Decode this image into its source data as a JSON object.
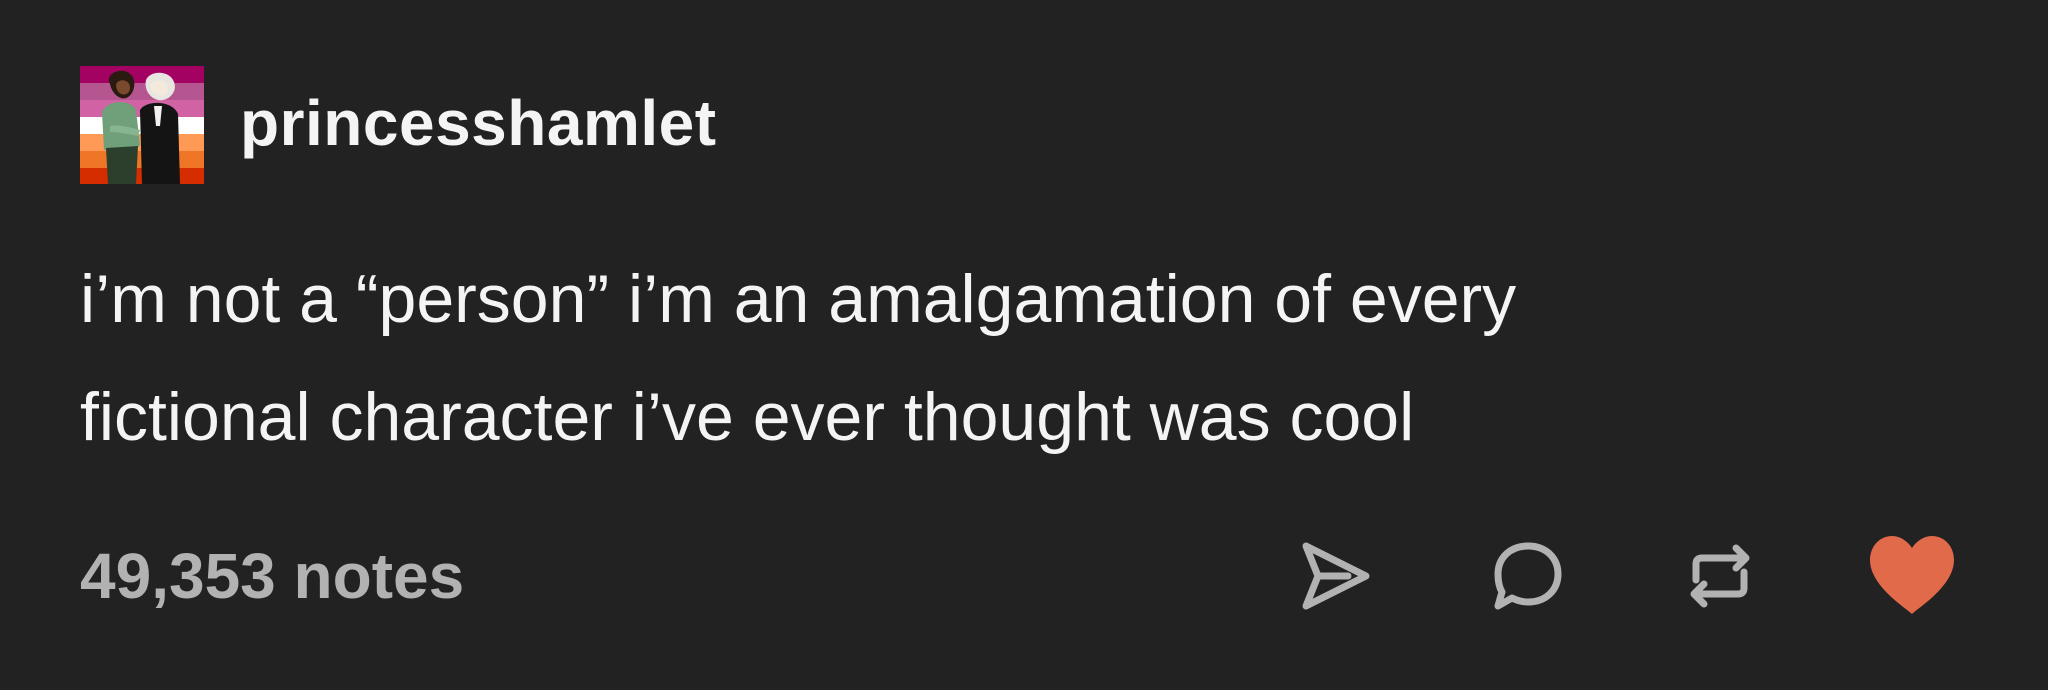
{
  "post": {
    "username": "princesshamlet",
    "text_lines": [
      "i’m not a “person” i’m an amalgamation of every",
      "fictional character i’ve ever thought was cool"
    ],
    "notes_label": "49,353 notes"
  },
  "icons": {
    "share": "share-icon",
    "reply": "reply-icon",
    "reblog": "reblog-icon",
    "like": "heart-icon"
  },
  "colors": {
    "background": "#222222",
    "text": "#f4f4f4",
    "muted": "#b2b2b2",
    "heart": "#e06a4a",
    "avatar_flag": [
      "#a30262",
      "#b55690",
      "#d162a4",
      "#ffffff",
      "#ff9a56",
      "#ef7627",
      "#d52d00"
    ]
  }
}
